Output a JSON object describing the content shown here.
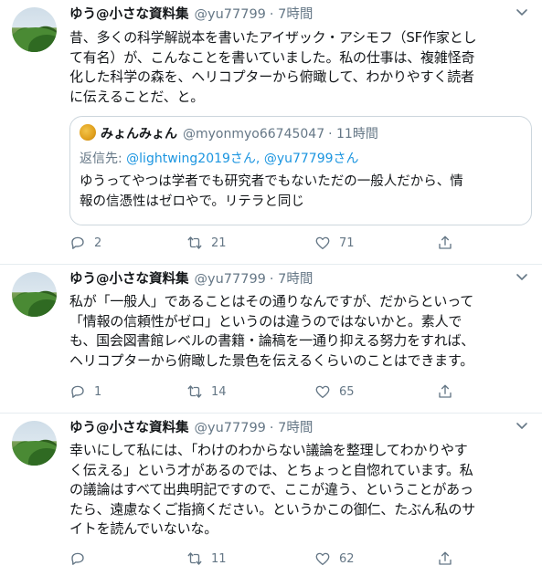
{
  "tweets": [
    {
      "name": "ゆう@小さな資料集",
      "handle": "@yu77799",
      "time": "· 7時間",
      "lines": [
        "昔、多くの科学解説本を書いたアイザック・アシモフ（SF作家とし",
        "て有名）が、こんなことを書いていました。私の仕事は、複雑怪奇",
        "化した科学の森を、ヘリコプターから俯瞰して、わかりやすく読者",
        "に伝えることだ、と。"
      ],
      "quote": {
        "name": "みょんみょん",
        "handle": "@myonmyo66745047",
        "time": "· 11時間",
        "reply_prefix": "返信先: ",
        "reply_targets": "@lightwing2019さん, @yu77799さん",
        "lines": [
          "ゆうってやつは学者でも研究者でもないただの一般人だから、情",
          "報の信憑性はゼロやで。リテラと同じ"
        ]
      },
      "replies": "2",
      "retweets": "21",
      "likes": "71"
    },
    {
      "name": "ゆう@小さな資料集",
      "handle": "@yu77799",
      "time": "· 7時間",
      "lines": [
        "私が「一般人」であることはその通りなんですが、だからといって",
        "「情報の信頼性がゼロ」というのは違うのではないかと。素人で",
        "も、国会図書館レベルの書籍・論稿を一通り抑える努力をすれば、",
        "ヘリコプターから俯瞰した景色を伝えるくらいのことはできます。"
      ],
      "replies": "1",
      "retweets": "14",
      "likes": "65"
    },
    {
      "name": "ゆう@小さな資料集",
      "handle": "@yu77799",
      "time": "· 7時間",
      "lines": [
        "幸いにして私には、「わけのわからない議論を整理してわかりやす",
        "く伝える」という才があるのでは、とちょっと自惚れています。私",
        "の議論はすべて出典明記ですので、ここが違う、ということがあっ",
        "たら、遠慮なくご指摘ください。というかこの御仁、たぶん私のサ",
        "イトを読んでいないな。"
      ],
      "replies": "",
      "retweets": "11",
      "likes": "62"
    }
  ],
  "icons": {
    "more": "chevron-down-icon",
    "reply": "reply-icon",
    "retweet": "retweet-icon",
    "like": "heart-icon",
    "share": "share-icon"
  },
  "colors": {
    "link": "#1b95e0",
    "muted": "#657786",
    "border": "#ccd6dd"
  }
}
